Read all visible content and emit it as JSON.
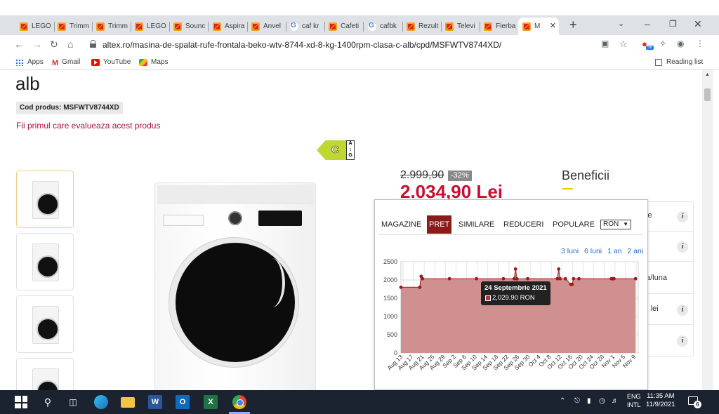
{
  "browser": {
    "tabs": [
      {
        "title": "LEGO",
        "favicon": "altex-icon"
      },
      {
        "title": "Trimm",
        "favicon": "altex-icon"
      },
      {
        "title": "Trimm",
        "favicon": "altex-icon"
      },
      {
        "title": "LEGO",
        "favicon": "altex-icon"
      },
      {
        "title": "Sounc",
        "favicon": "altex-icon"
      },
      {
        "title": "Aspira",
        "favicon": "altex-icon"
      },
      {
        "title": "Anvel",
        "favicon": "altex-icon"
      },
      {
        "title": "caf kr",
        "favicon": "google-icon"
      },
      {
        "title": "Cafeti",
        "favicon": "altex-icon"
      },
      {
        "title": "cafbk",
        "favicon": "google-icon"
      },
      {
        "title": "Rezult",
        "favicon": "altex-icon"
      },
      {
        "title": "Televi",
        "favicon": "altex-icon"
      },
      {
        "title": "Fierba",
        "favicon": "altex-icon"
      },
      {
        "title": "M",
        "favicon": "altex-icon",
        "active": true
      }
    ],
    "new_tab": "+",
    "url": "altex.ro/masina-de-spalat-rufe-frontala-beko-wtv-8744-xd-8-kg-1400rpm-clasa-c-alb/cpd/MSFWTV8744XD/",
    "extension_badge": "56",
    "bookmarks": [
      {
        "label": "Apps",
        "icon": "apps-icon"
      },
      {
        "label": "Gmail",
        "icon": "gmail-icon"
      },
      {
        "label": "YouTube",
        "icon": "youtube-icon"
      },
      {
        "label": "Maps",
        "icon": "maps-icon"
      }
    ],
    "reading_list": "Reading list"
  },
  "product": {
    "title": "alb",
    "code_label": "Cod produs: MSFWTV8744XD",
    "review_link": "Fii primul care evalueaza acest produs",
    "energy_class": "C",
    "energy_scale_top": "A",
    "energy_scale_bottom": "G",
    "old_price": "2.999,90",
    "discount": "-32%",
    "new_price": "2.034,90 Lei"
  },
  "benefits": {
    "title": "Beneficii",
    "rows": [
      {
        "text": "le"
      },
      {
        "text": ""
      },
      {
        "text": "a/luna"
      },
      {
        "text": ") lei"
      },
      {
        "text": ""
      }
    ],
    "info_glyph": "i"
  },
  "price_history": {
    "tabs": [
      "MAGAZINE",
      "PRET",
      "SIMILARE",
      "REDUCERI",
      "POPULARE"
    ],
    "active_tab": "PRET",
    "currency": "RON",
    "ranges": [
      "3 luni",
      "6 luni",
      "1 an",
      "2 ani"
    ],
    "tooltip": {
      "date": "24 Septembrie 2021",
      "value": "2,029.90 RON"
    },
    "colors": {
      "fill": "#cd8a8a",
      "line": "#a83030",
      "point": "#9b1b1b"
    }
  },
  "chart_data": {
    "type": "area",
    "x_tick_labels": [
      "Aug 13",
      "Aug 17",
      "Aug 21",
      "Aug 25",
      "Aug 29",
      "Sep 2",
      "Sep 6",
      "Sep 10",
      "Sep 14",
      "Sep 18",
      "Sep 22",
      "Sep 26",
      "Sep 30",
      "Oct 4",
      "Oct 8",
      "Oct 12",
      "Oct 16",
      "Oct 20",
      "Oct 24",
      "Oct 28",
      "Nov 1",
      "Nov 5",
      "Nov 9"
    ],
    "y_ticks": [
      0,
      500,
      1000,
      1500,
      2000,
      2500
    ],
    "ylim": [
      0,
      2500
    ],
    "grid": true,
    "series": [
      {
        "x_days": [
          0,
          7,
          7.5,
          8,
          18,
          28,
          38,
          42,
          42.5,
          43,
          47,
          58,
          58.5,
          59,
          61,
          63,
          63.5,
          64,
          66,
          78,
          78.5,
          79,
          87
        ],
        "dates": [
          "Aug 13",
          "Aug 20",
          "Aug 20",
          "Aug 21",
          "Aug 31",
          "Sep 10",
          "Sep 20",
          "Sep 24",
          "Sep 24",
          "Sep 25",
          "Sep 29",
          "Oct 10",
          "Oct 10",
          "Oct 11",
          "Oct 13",
          "Oct 15",
          "Oct 15",
          "Oct 16",
          "Oct 18",
          "Oct 30",
          "Oct 30",
          "Oct 31",
          "Nov 8"
        ],
        "values": [
          1800,
          1800,
          2100,
          2034.9,
          2034.9,
          2034.9,
          2034.9,
          2034.9,
          2300,
          2029.9,
          2034.9,
          2034.9,
          2300,
          2034.9,
          2034.9,
          1880,
          1880,
          2034.9,
          2034.9,
          2034.9,
          2034.9,
          2034.9,
          2034.9
        ]
      }
    ]
  },
  "taskbar": {
    "language": [
      "ENG",
      "INTL"
    ],
    "time": "11:35 AM",
    "date": "11/9/2021",
    "notifications": "6"
  }
}
